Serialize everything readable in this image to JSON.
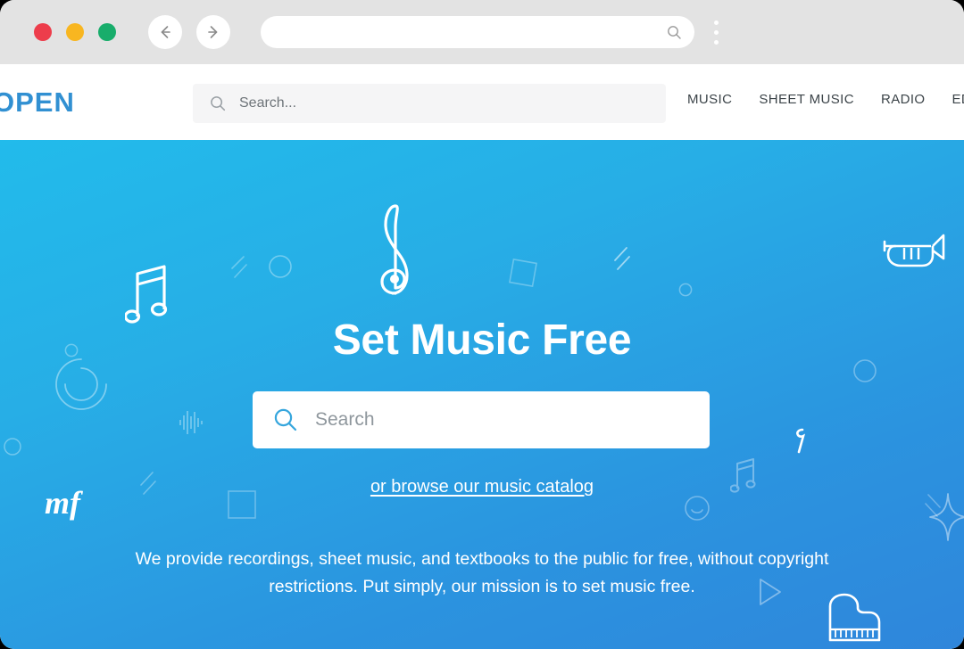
{
  "browser": {
    "traffic_lights": [
      {
        "name": "close",
        "color": "#ed3d4b"
      },
      {
        "name": "minimize",
        "color": "#f8b620"
      },
      {
        "name": "maximize",
        "color": "#18ad6b"
      }
    ],
    "back_icon": "arrow-left-icon",
    "forward_icon": "arrow-right-icon",
    "url_value": "",
    "url_search_icon": "search-icon",
    "menu_icon": "kebab-menu-icon"
  },
  "site_header": {
    "logo_text": "OPEN",
    "logo_color": "#3190d2",
    "search": {
      "icon": "search-icon",
      "placeholder": "Search...",
      "value": ""
    },
    "nav": [
      {
        "label": "MUSIC"
      },
      {
        "label": "SHEET MUSIC"
      },
      {
        "label": "RADIO"
      },
      {
        "label": "EDUCATION"
      }
    ]
  },
  "hero": {
    "background_top_color": "#22bbeb",
    "background_bottom_color": "#2f86db",
    "title": "Set Music Free",
    "search": {
      "icon": "search-icon",
      "placeholder": "Search",
      "value": ""
    },
    "browse_link": "or browse our music catalog",
    "description": "We provide recordings, sheet music, and textbooks to the public for free, without copyright restrictions. Put simply, our mission is to set music free.",
    "decorations": [
      "treble-clef-icon",
      "beamed-eighth-notes-icon",
      "trumpet-icon",
      "grand-piano-icon",
      "mezzo-forte-icon",
      "eighth-rest-icon",
      "waveform-icon",
      "play-triangle-icon",
      "sparkle-icon",
      "circle-outline-icon",
      "square-outline-icon",
      "arc-outline-icon",
      "slash-lines-icon",
      "smiley-icon"
    ]
  }
}
